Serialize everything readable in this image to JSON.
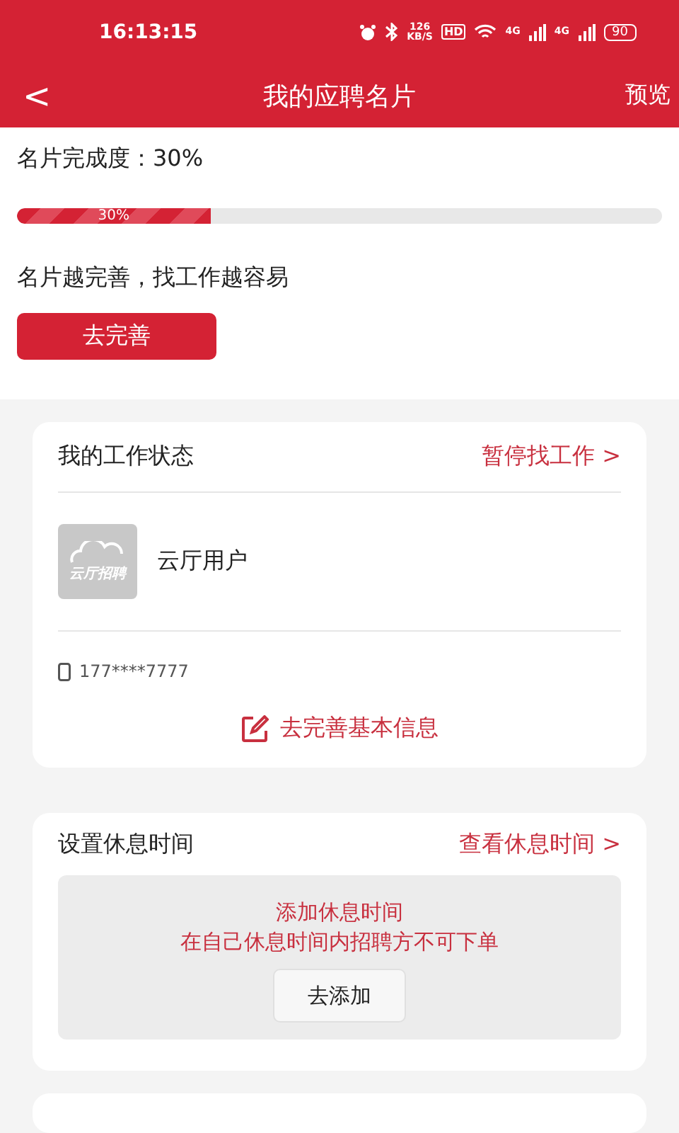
{
  "status_bar": {
    "time": "16:13:15",
    "speed": "126",
    "speed_unit": "KB/S",
    "hd": "HD",
    "signal_labels": [
      "4G",
      "4G"
    ],
    "battery": "90"
  },
  "header": {
    "back": "<",
    "title": "我的应聘名片",
    "action": "预览"
  },
  "completion": {
    "label": "名片完成度：30%",
    "level": 0.3,
    "reading": "30%",
    "hint": "名片越完善，找工作越容易",
    "button": "去完善"
  },
  "work_status": {
    "title": "我的工作状态",
    "link": "暂停找工作 >",
    "logo_text": "云厅招聘",
    "name": "云厅用户",
    "phone": "177****7777",
    "action": "去完善基本信息"
  },
  "rest_time": {
    "title": "设置休息时间",
    "link": "查看休息时间 >",
    "notice": [
      "添加休息时间",
      "在自己休息时间内招聘方不可下单"
    ],
    "button": "去添加"
  }
}
